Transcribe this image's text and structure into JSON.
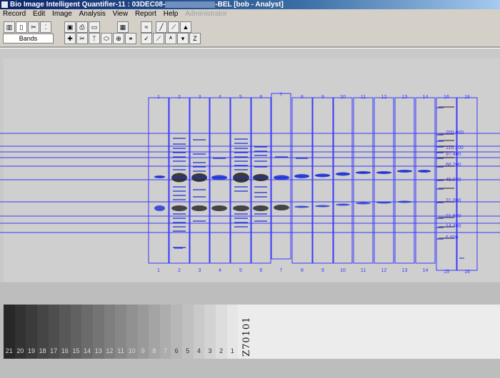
{
  "window": {
    "title": "Bio Image Intelligent Quantifier-11 : 03DEC08-",
    "title_suffix": "-BEL  [bob - Analyst]"
  },
  "menu": [
    "Record",
    "Edit",
    "Image",
    "Analysis",
    "View",
    "Report",
    "Help"
  ],
  "menu_disabled": "Administrator",
  "mode": {
    "label": "Bands"
  },
  "lanes_top": [
    "1",
    "2",
    "3",
    "4",
    "5",
    "6",
    "7",
    "8",
    "9",
    "10",
    "11",
    "12",
    "13",
    "14",
    "16",
    "18"
  ],
  "lanes_bottom": [
    "1",
    "2",
    "3",
    "4",
    "5",
    "6",
    "7",
    "8",
    "9",
    "10",
    "11",
    "12",
    "13",
    "14",
    "15",
    "16"
  ],
  "mw_labels": [
    "200.000",
    "116.300",
    "97.400",
    "66.200",
    "45.000",
    "31.000",
    "21.500",
    "14.400",
    "6.500"
  ],
  "grayscale_steps": [
    "21",
    "20",
    "19",
    "18",
    "17",
    "16",
    "15",
    "14",
    "13",
    "12",
    "11",
    "10",
    "9",
    "8",
    "7",
    "6",
    "5",
    "4",
    "3",
    "2",
    "1"
  ],
  "handwritten_label": "Z70101",
  "colors": {
    "lane_outline": "#3a3aff",
    "band_blue": "#1a2fd6",
    "band_dark": "#202020",
    "title_start": "#0a246a"
  }
}
